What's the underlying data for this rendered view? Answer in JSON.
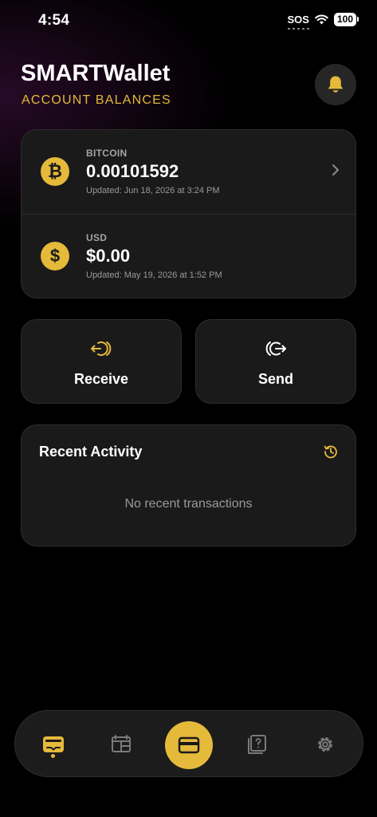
{
  "status_bar": {
    "time": "4:54",
    "sos": "SOS",
    "battery": "100"
  },
  "header": {
    "title": "SMARTWallet",
    "subtitle": "ACCOUNT BALANCES",
    "bell_icon": "bell-icon"
  },
  "balances": [
    {
      "label": "BITCOIN",
      "value": "0.00101592",
      "updated": "Updated: Jun 18, 2026 at 3:24 PM",
      "symbol": "₿"
    },
    {
      "label": "USD",
      "value": "$0.00",
      "updated": "Updated: May 19, 2026 at 1:52 PM",
      "symbol": "$"
    }
  ],
  "actions": {
    "receive": "Receive",
    "send": "Send"
  },
  "activity": {
    "title": "Recent Activity",
    "empty": "No recent transactions"
  },
  "tabs": [
    {
      "icon": "wallet-icon",
      "active": true
    },
    {
      "icon": "dashboard-icon",
      "active": false
    },
    {
      "icon": "card-icon",
      "active": false
    },
    {
      "icon": "help-book-icon",
      "active": false
    },
    {
      "icon": "settings-gear-icon",
      "active": false
    }
  ],
  "colors": {
    "accent": "#e5b93a",
    "card": "#1a1a1a",
    "background": "#000000"
  }
}
